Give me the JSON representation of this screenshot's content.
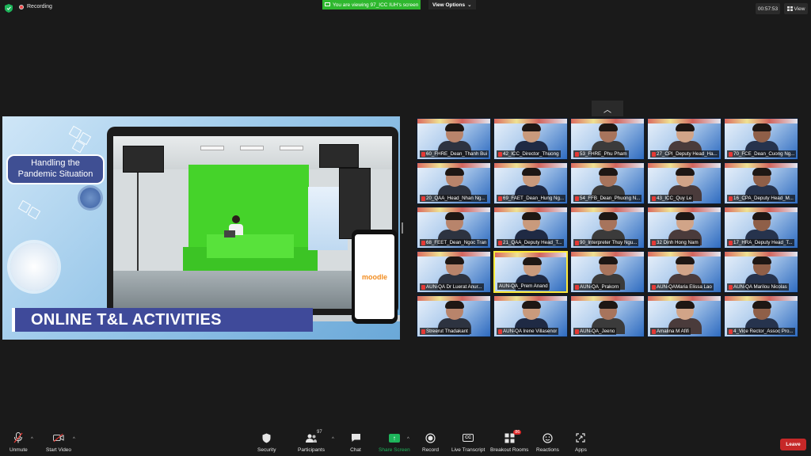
{
  "topbar": {
    "recording_label": "Recording",
    "viewing_label": "You are viewing 97_ICC IUH's screen",
    "view_options_label": "View Options",
    "timer": "00:57:53",
    "view_label": "View"
  },
  "share": {
    "pandemic_title": "Handling the Pandemic Situation",
    "banner_title": "ONLINE T&L ACTIVITIES",
    "phone_logo": "moodle"
  },
  "gallery": {
    "tiles": [
      {
        "name": "60_FHRE_Dean_Thanh Bui",
        "mic_off": true
      },
      {
        "name": "42_ICC_Director_Thuong",
        "mic_off": true
      },
      {
        "name": "53_FHRE_Phu Pham",
        "mic_off": true
      },
      {
        "name": "27_CPI_Deputy Head_Ha...",
        "mic_off": true
      },
      {
        "name": "70_FCE_Dean_Cuong Ng...",
        "mic_off": true
      },
      {
        "name": "20_QAA_Head_Nhan Ng...",
        "mic_off": true
      },
      {
        "name": "69_FAET_Dean_Hung Ng...",
        "mic_off": true
      },
      {
        "name": "54_FFB_Dean_Phuong N...",
        "mic_off": true
      },
      {
        "name": "43_ICC_Quy Le",
        "mic_off": true
      },
      {
        "name": "16_CPA_Deputy Head_M...",
        "mic_off": true
      },
      {
        "name": "68_FEET_Dean_Ngoc Tran",
        "mic_off": true
      },
      {
        "name": "21_QAA_Deputy Head_T...",
        "mic_off": true
      },
      {
        "name": "90_Interpreter Thuy Ngu...",
        "mic_off": true
      },
      {
        "name": "32 Dinh Hong Nam",
        "mic_off": true
      },
      {
        "name": "17_HRA_Deputy Head_T...",
        "mic_off": true
      },
      {
        "name": "AUN-QA Dr Luerat Anur...",
        "mic_off": true
      },
      {
        "name": "AUN-QA_Prem Anand",
        "mic_off": false
      },
      {
        "name": "AUN-QA_Prakorn",
        "mic_off": true
      },
      {
        "name": "AUN-QAMaria Elissa Lao",
        "mic_off": true
      },
      {
        "name": "AUN-QA Marilou Nicolas",
        "mic_off": true
      },
      {
        "name": "Streerut Thadakant",
        "mic_off": true
      },
      {
        "name": "AUN-QA Irene Villasenor",
        "mic_off": true
      },
      {
        "name": "AUN-QA_Jeeno",
        "mic_off": true
      },
      {
        "name": "Amalina M Afifi",
        "mic_off": true
      },
      {
        "name": "4_Vice Rector_Assoc Pro...",
        "mic_off": true
      }
    ]
  },
  "toolbar": {
    "unmute_label": "Unmute",
    "start_video_label": "Start Video",
    "security_label": "Security",
    "participants_label": "Participants",
    "participants_count": "97",
    "chat_label": "Chat",
    "share_screen_label": "Share Screen",
    "record_label": "Record",
    "live_transcript_label": "Live Transcript",
    "breakout_rooms_label": "Breakout Rooms",
    "breakout_badge": "86",
    "reactions_label": "Reactions",
    "apps_label": "Apps",
    "leave_label": "Leave",
    "cc_label": "CC"
  },
  "colors": {
    "background": "#1a1a1a",
    "viewing_green": "#2eb82e",
    "leave_red": "#c62828",
    "share_green": "#1eb55b"
  }
}
